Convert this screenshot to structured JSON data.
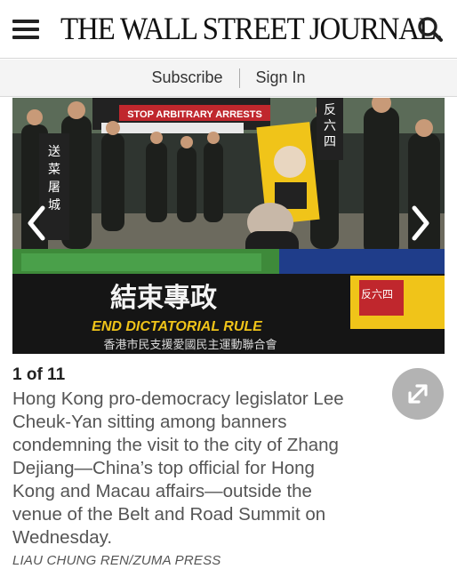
{
  "header": {
    "masthead": "THE WALL STREET JOURNAL.",
    "menu_icon": "hamburger-menu-icon",
    "search_icon": "search-icon"
  },
  "account": {
    "subscribe_label": "Subscribe",
    "signin_label": "Sign In"
  },
  "slideshow": {
    "photo": {
      "banner_top": "STOP ARBITRARY ARRESTS",
      "banner_chinese": "結束專政",
      "banner_english": "END DICTATORIAL RULE",
      "banner_org": "香港市民支援愛國民主運動聯合會",
      "side_sign": "反六四",
      "left_sign": "送菜屠城",
      "right_sign": "反六四"
    },
    "prev_icon": "chevron-left-icon",
    "next_icon": "chevron-right-icon",
    "counter": "1 of 11",
    "expand_icon": "expand-icon",
    "caption": "Hong Kong pro-democracy legislator Lee Cheuk-Yan sitting among banners condemning the visit to the city of Zhang Dejiang—China’s top official for Hong Kong and Macau affairs—outside the venue of the Belt and Road Summit on Wednesday.",
    "credit": "LIAU CHUNG REN/ZUMA PRESS"
  },
  "colors": {
    "banner_yellow": "#f0c419",
    "banner_red": "#c0272d",
    "expand_bg": "#b3b3b3"
  }
}
